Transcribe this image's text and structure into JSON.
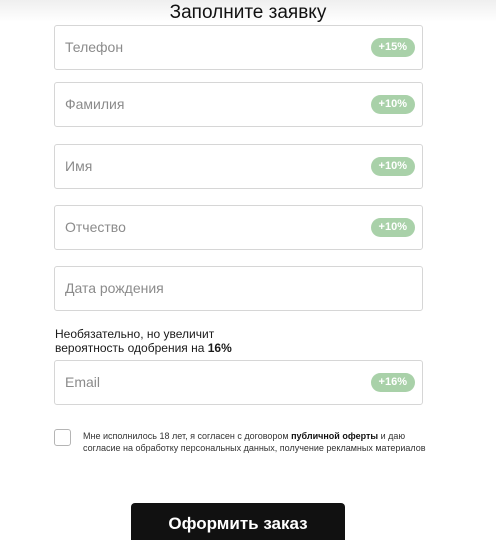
{
  "form": {
    "title": "Заполните заявку",
    "fields": [
      {
        "placeholder": "Телефон",
        "bonus": "+15%"
      },
      {
        "placeholder": "Фамилия",
        "bonus": "+10%"
      },
      {
        "placeholder": "Имя",
        "bonus": "+10%"
      },
      {
        "placeholder": "Отчество",
        "bonus": "+10%"
      },
      {
        "placeholder": "Дата рождения",
        "bonus": ""
      },
      {
        "placeholder": "Email",
        "bonus": "+16%"
      }
    ],
    "optional_note": {
      "line1": "Необязательно, но увеличит",
      "line2_prefix": "вероятность одобрения на ",
      "line2_value": "16%"
    },
    "consent": {
      "prefix": "Мне исполнилось 18 лет, я согласен с договором ",
      "link": "публичной оферты",
      "suffix": " и даю согласие на обработку персональных данных, получение рекламных материалов"
    },
    "submit_label": "Оформить заказ"
  },
  "colors": {
    "badge_bg": "#a9d1a9",
    "button_bg": "#111111"
  }
}
